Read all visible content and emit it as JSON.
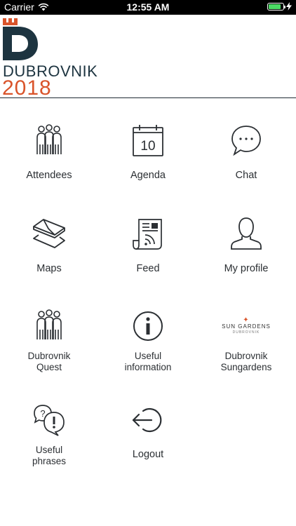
{
  "status_bar": {
    "carrier": "Carrier",
    "time": "12:55 AM",
    "battery_level": 0.85
  },
  "header": {
    "logo_word": "DUBROVNIK",
    "logo_year": "2018"
  },
  "colors": {
    "brand_dark": "#1d3440",
    "brand_accent": "#d9542b",
    "icon_stroke": "#2b2f33"
  },
  "menu": {
    "attendees": "Attendees",
    "agenda": "Agenda",
    "agenda_day": "10",
    "chat": "Chat",
    "maps": "Maps",
    "feed": "Feed",
    "my_profile": "My profile",
    "quest_line1": "Dubrovnik",
    "quest_line2": "Quest",
    "useful_info_line1": "Useful",
    "useful_info_line2": "information",
    "sungardens_line1": "Dubrovnik",
    "sungardens_line2": "Sungardens",
    "sungardens_logo": "SUN GARDENS",
    "sungardens_logo_sub": "DUBROVNIK",
    "phrases_line1": "Useful",
    "phrases_line2": "phrases",
    "logout": "Logout"
  }
}
